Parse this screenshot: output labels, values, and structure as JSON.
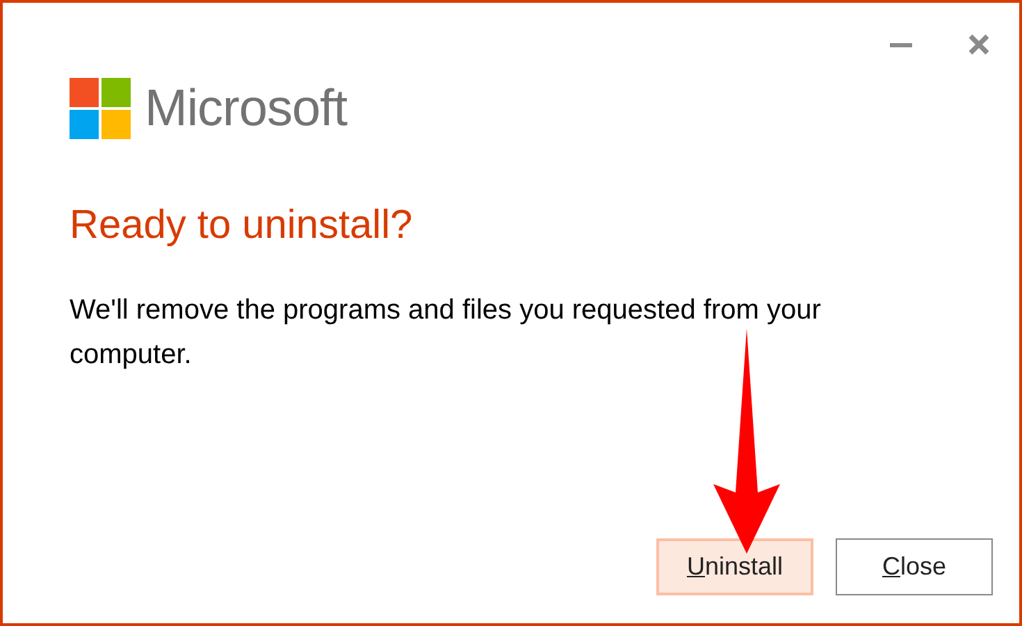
{
  "window": {
    "controls": [
      {
        "kind": "minimize"
      },
      {
        "kind": "close"
      }
    ]
  },
  "logo": {
    "wordmark": "Microsoft"
  },
  "heading": "Ready to uninstall?",
  "message": "We'll remove the programs and files you requested from your computer.",
  "buttons": [
    {
      "label": "Uninstall",
      "access_key_underlined": true,
      "focused": true
    },
    {
      "label": "Close",
      "access_key_underlined": true,
      "focused": false
    }
  ]
}
